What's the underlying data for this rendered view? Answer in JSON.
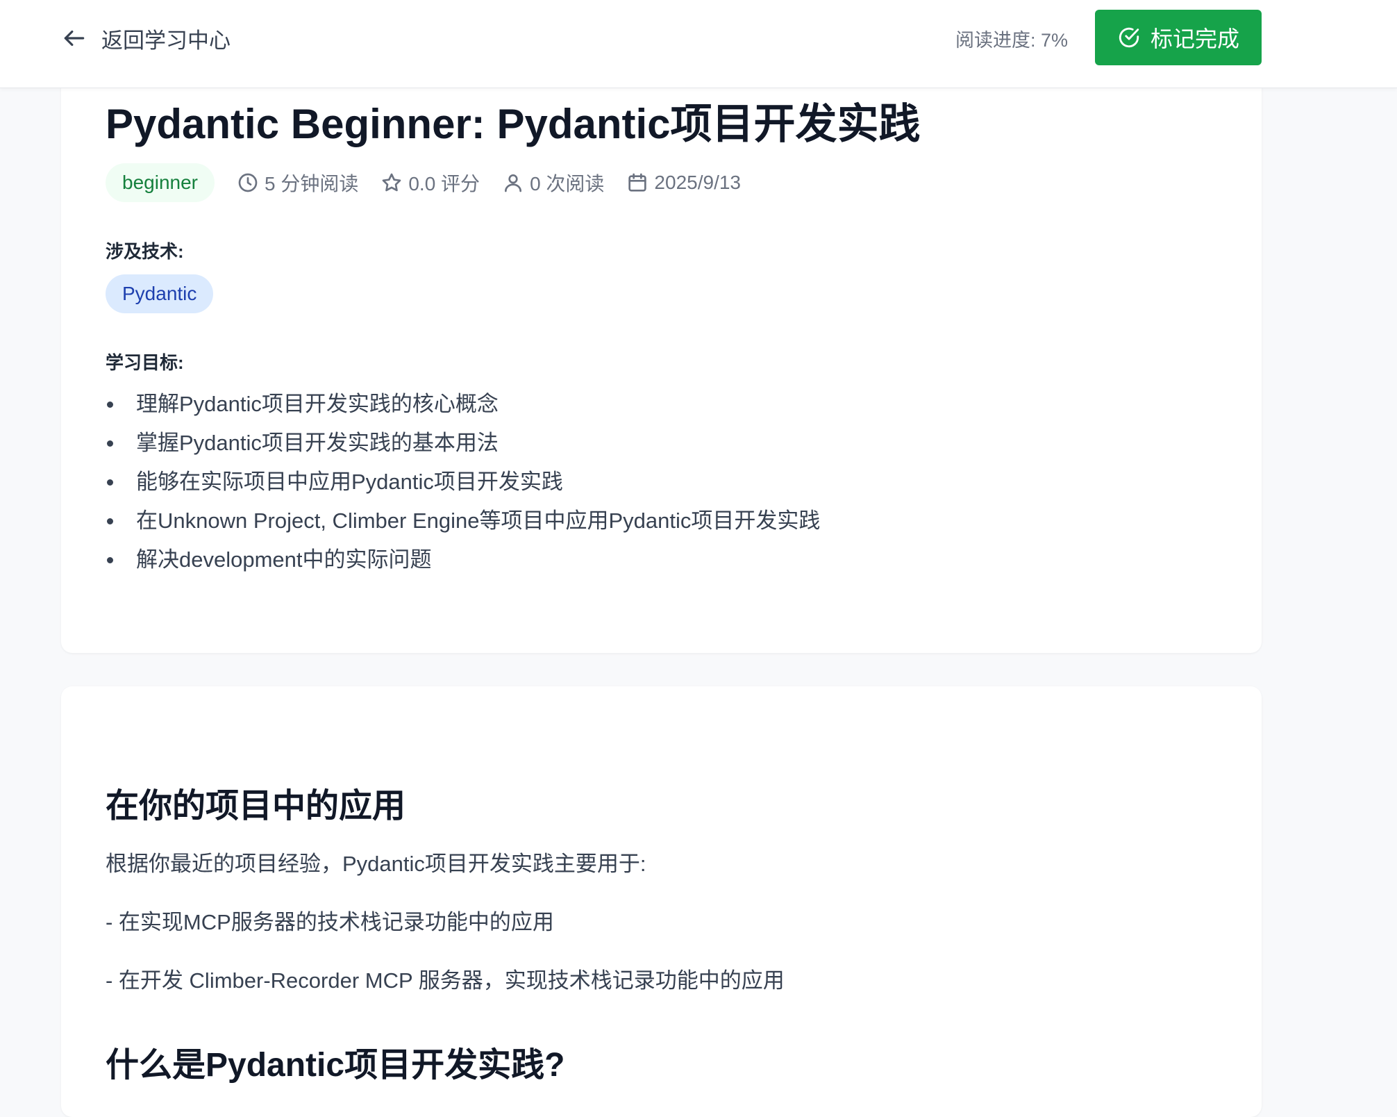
{
  "header": {
    "back_label": "返回学习中心",
    "progress_label": "阅读进度: 7%",
    "progress_percent": 7,
    "complete_button_label": "标记完成",
    "accent_color": "#16a34a"
  },
  "article": {
    "title": "Pydantic Beginner: Pydantic项目开发实践",
    "level": "beginner",
    "read_time": "5 分钟阅读",
    "rating": "0.0 评分",
    "views": "0 次阅读",
    "date": "2025/9/13",
    "tech_label": "涉及技术:",
    "technologies": [
      "Pydantic"
    ],
    "goals_label": "学习目标:",
    "goals": [
      "理解Pydantic项目开发实践的核心概念",
      "掌握Pydantic项目开发实践的基本用法",
      "能够在实际项目中应用Pydantic项目开发实践",
      "在Unknown Project, Climber Engine等项目中应用Pydantic项目开发实践",
      "解决development中的实际问题"
    ]
  },
  "content": {
    "application_heading": "在你的项目中的应用",
    "application_intro": "根据你最近的项目经验，Pydantic项目开发实践主要用于:",
    "application_points": [
      "- 在实现MCP服务器的技术栈记录功能中的应用",
      "- 在开发 Climber-Recorder MCP 服务器，实现技术栈记录功能中的应用"
    ],
    "what_is_heading": "什么是Pydantic项目开发实践?"
  }
}
